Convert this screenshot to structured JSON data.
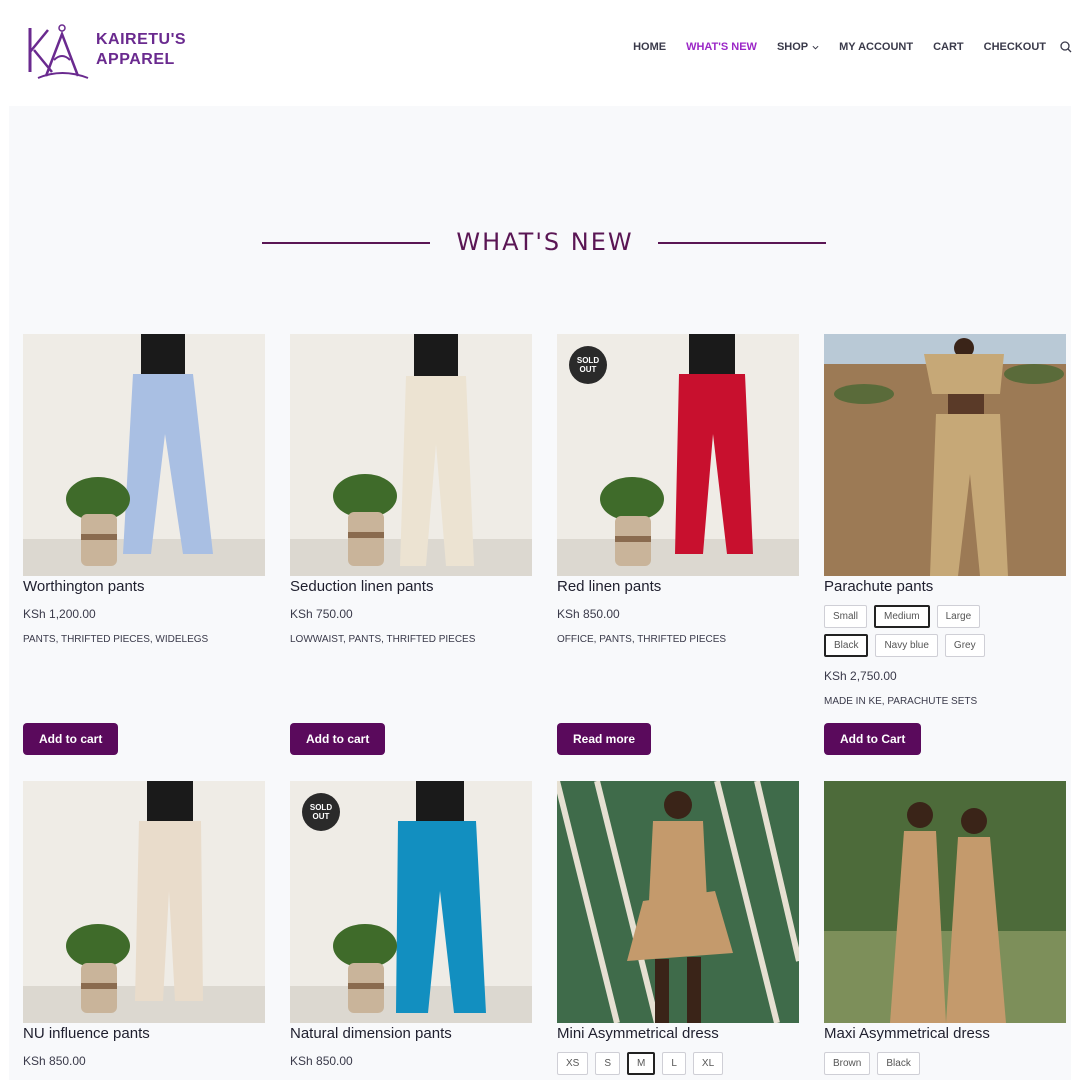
{
  "brand": {
    "line1": "KAIRETU'S",
    "line2": "APPAREL",
    "color": "#6a2a8f"
  },
  "nav": {
    "items": [
      {
        "label": "HOME",
        "active": false
      },
      {
        "label": "WHAT'S NEW",
        "active": true
      },
      {
        "label": "SHOP",
        "active": false,
        "dropdown": true
      },
      {
        "label": "MY ACCOUNT",
        "active": false
      },
      {
        "label": "CART",
        "active": false
      },
      {
        "label": "CHECKOUT",
        "active": false
      }
    ],
    "search_icon": "search-icon"
  },
  "section": {
    "title": "WHAT'S NEW",
    "accent": "#5a1654"
  },
  "products": [
    {
      "name": "Worthington pants",
      "price": "KSh 1,200.00",
      "categories": "PANTS, THRIFTED PIECES, WIDELEGS",
      "button": "Add to cart",
      "sold_out": false,
      "color": "#a9bfe3"
    },
    {
      "name": "Seduction linen pants",
      "price": "KSh 750.00",
      "categories": "LOWWAIST, PANTS, THRIFTED PIECES",
      "button": "Add to cart",
      "sold_out": false,
      "color": "#ece3d2"
    },
    {
      "name": "Red linen pants",
      "price": "KSh 850.00",
      "categories": "OFFICE, PANTS, THRIFTED PIECES",
      "button": "Read more",
      "sold_out": true,
      "badge": [
        "SOLD",
        "OUT"
      ],
      "color": "#c8102e"
    },
    {
      "name": "Parachute pants",
      "price": "KSh 2,750.00",
      "categories": "MADE IN KE, PARACHUTE SETS",
      "button": "Add to Cart",
      "sold_out": false,
      "color": "#c6a877",
      "sizes": [
        "Small",
        "Medium",
        "Large"
      ],
      "selected_size": "Medium",
      "colors": [
        "Black",
        "Navy blue",
        "Grey"
      ],
      "selected_color": "Black"
    },
    {
      "name": "NU influence pants",
      "price": "KSh 850.00",
      "sold_out": false,
      "color": "#e9dccb"
    },
    {
      "name": "Natural dimension pants",
      "price": "KSh 850.00",
      "sold_out": true,
      "badge": [
        "SOLD",
        "OUT"
      ],
      "color": "#128fc0"
    },
    {
      "name": "Mini Asymmetrical dress",
      "sold_out": false,
      "color": "#c49a6c",
      "sizes": [
        "XS",
        "S",
        "M",
        "L",
        "XL"
      ],
      "selected_size": "M"
    },
    {
      "name": "Maxi Asymmetrical dress",
      "sold_out": false,
      "color": "#c49a6c",
      "colors": [
        "Brown",
        "Black"
      ]
    }
  ],
  "colors": {
    "button": "#5a0a5c",
    "nav_active": "#9b27c7",
    "background": "#f8f9fb"
  }
}
